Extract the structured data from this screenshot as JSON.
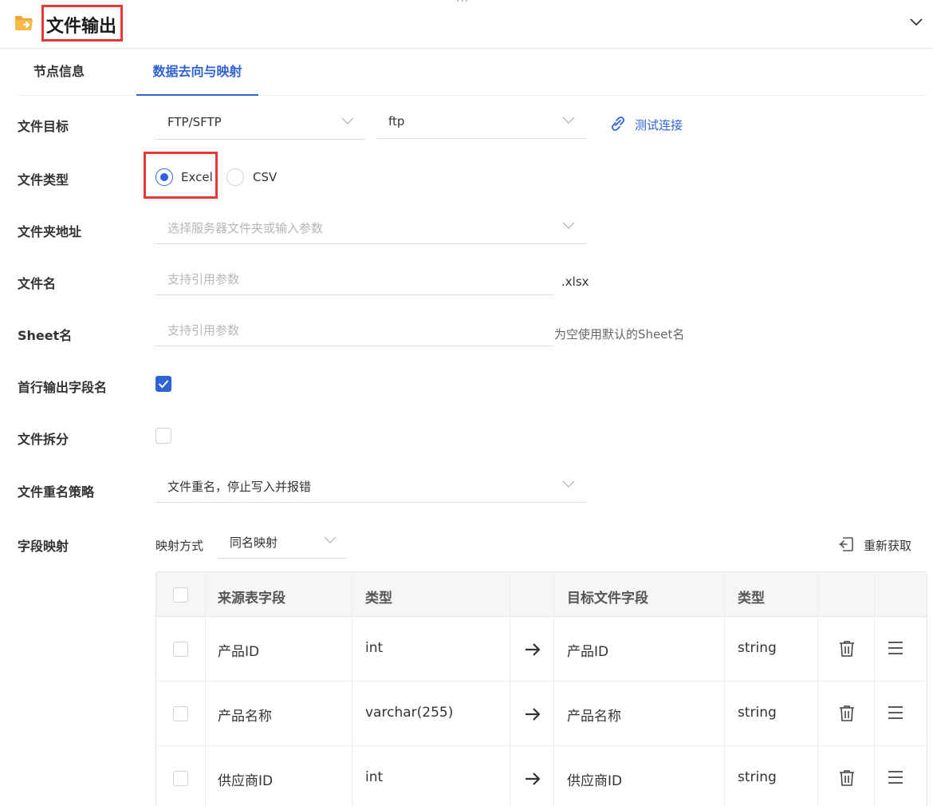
{
  "header": {
    "title": "文件输出",
    "drag_handle": "···",
    "icons": {
      "folder": "folder-export-icon",
      "collapse": "chevron-down-icon"
    }
  },
  "tabs": [
    {
      "label": "节点信息",
      "active": false
    },
    {
      "label": "数据去向与映射",
      "active": true
    }
  ],
  "form": {
    "file_target": {
      "label": "文件目标",
      "protocol": "FTP/SFTP",
      "connection": "ftp",
      "test_link": "测试连接"
    },
    "file_type": {
      "label": "文件类型",
      "options": [
        {
          "label": "Excel",
          "selected": true
        },
        {
          "label": "CSV",
          "selected": false
        }
      ]
    },
    "folder": {
      "label": "文件夹地址",
      "placeholder": "选择服务器文件夹或输入参数"
    },
    "file_name": {
      "label": "文件名",
      "placeholder": "支持引用参数",
      "suffix": ".xlsx"
    },
    "sheet_name": {
      "label": "Sheet名",
      "placeholder": "支持引用参数",
      "hint": "为空使用默认的Sheet名"
    },
    "header_row": {
      "label": "首行输出字段名",
      "checked": true
    },
    "file_split": {
      "label": "文件拆分",
      "checked": false
    },
    "rename_policy": {
      "label": "文件重名策略",
      "value": "文件重名，停止写入并报错"
    },
    "field_mapping": {
      "label": "字段映射",
      "mode_label": "映射方式",
      "mode_value": "同名映射",
      "refresh_label": "重新获取"
    }
  },
  "table": {
    "headers": {
      "source_field": "来源表字段",
      "source_type": "类型",
      "target_field": "目标文件字段",
      "target_type": "类型"
    },
    "rows": [
      {
        "source_field": "产品ID",
        "source_type": "int",
        "target_field": "产品ID",
        "target_type": "string"
      },
      {
        "source_field": "产品名称",
        "source_type": "varchar(255)",
        "target_field": "产品名称",
        "target_type": "string"
      },
      {
        "source_field": "供应商ID",
        "source_type": "int",
        "target_field": "供应商ID",
        "target_type": "string"
      }
    ],
    "row_icons": {
      "arrow": "arrow-right-icon",
      "delete": "trash-icon",
      "drag": "drag-handle-icon"
    }
  },
  "colors": {
    "accent": "#2f62d6",
    "highlight_border": "#e53935",
    "folder_icon": "#f0a530"
  }
}
